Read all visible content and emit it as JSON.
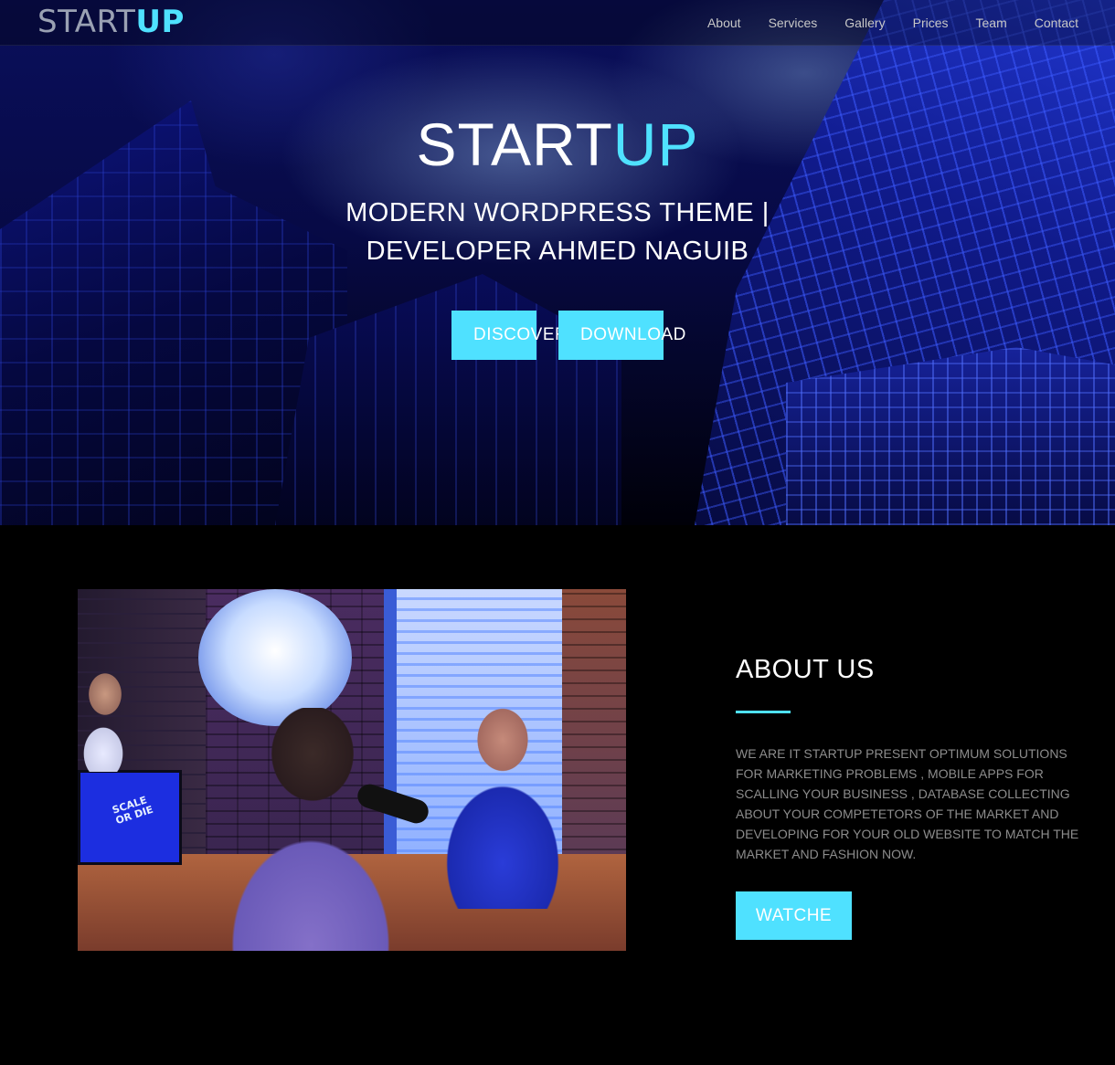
{
  "nav": {
    "brand_prefix": "START",
    "brand_accent": "UP",
    "links": [
      "About",
      "Services",
      "Gallery",
      "Prices",
      "Team",
      "Contact"
    ]
  },
  "hero": {
    "title_prefix": "START",
    "title_accent": "UP",
    "subtitle": "MODERN WORDPRESS THEME | DEVELOPER AHMED NAGUIB",
    "discover_label": "DISCOVER",
    "download_label": "DOWNLOAD"
  },
  "about": {
    "photo_monitor_text": "SCALE OR DIE",
    "heading": "ABOUT US",
    "description": "WE ARE IT STARTUP PRESENT OPTIMUM SOLUTIONS FOR MARKETING PROBLEMS , MOBILE APPS FOR SCALLING YOUR BUSINESS , DATABASE COLLECTING ABOUT YOUR COMPETETORS OF THE MARKET AND DEVELOPING FOR YOUR OLD WEBSITE TO MATCH THE MARKET AND FASHION NOW.",
    "watch_label": "WATCHE"
  },
  "colors": {
    "accent": "#4fe1ff",
    "background": "#000000",
    "muted_text": "#8c8c8c",
    "nav_text": "#c7c7c7"
  },
  "icons": {
    "hero_background": "city-skyscrapers-image",
    "about_image": "podcast-studio-photo"
  }
}
